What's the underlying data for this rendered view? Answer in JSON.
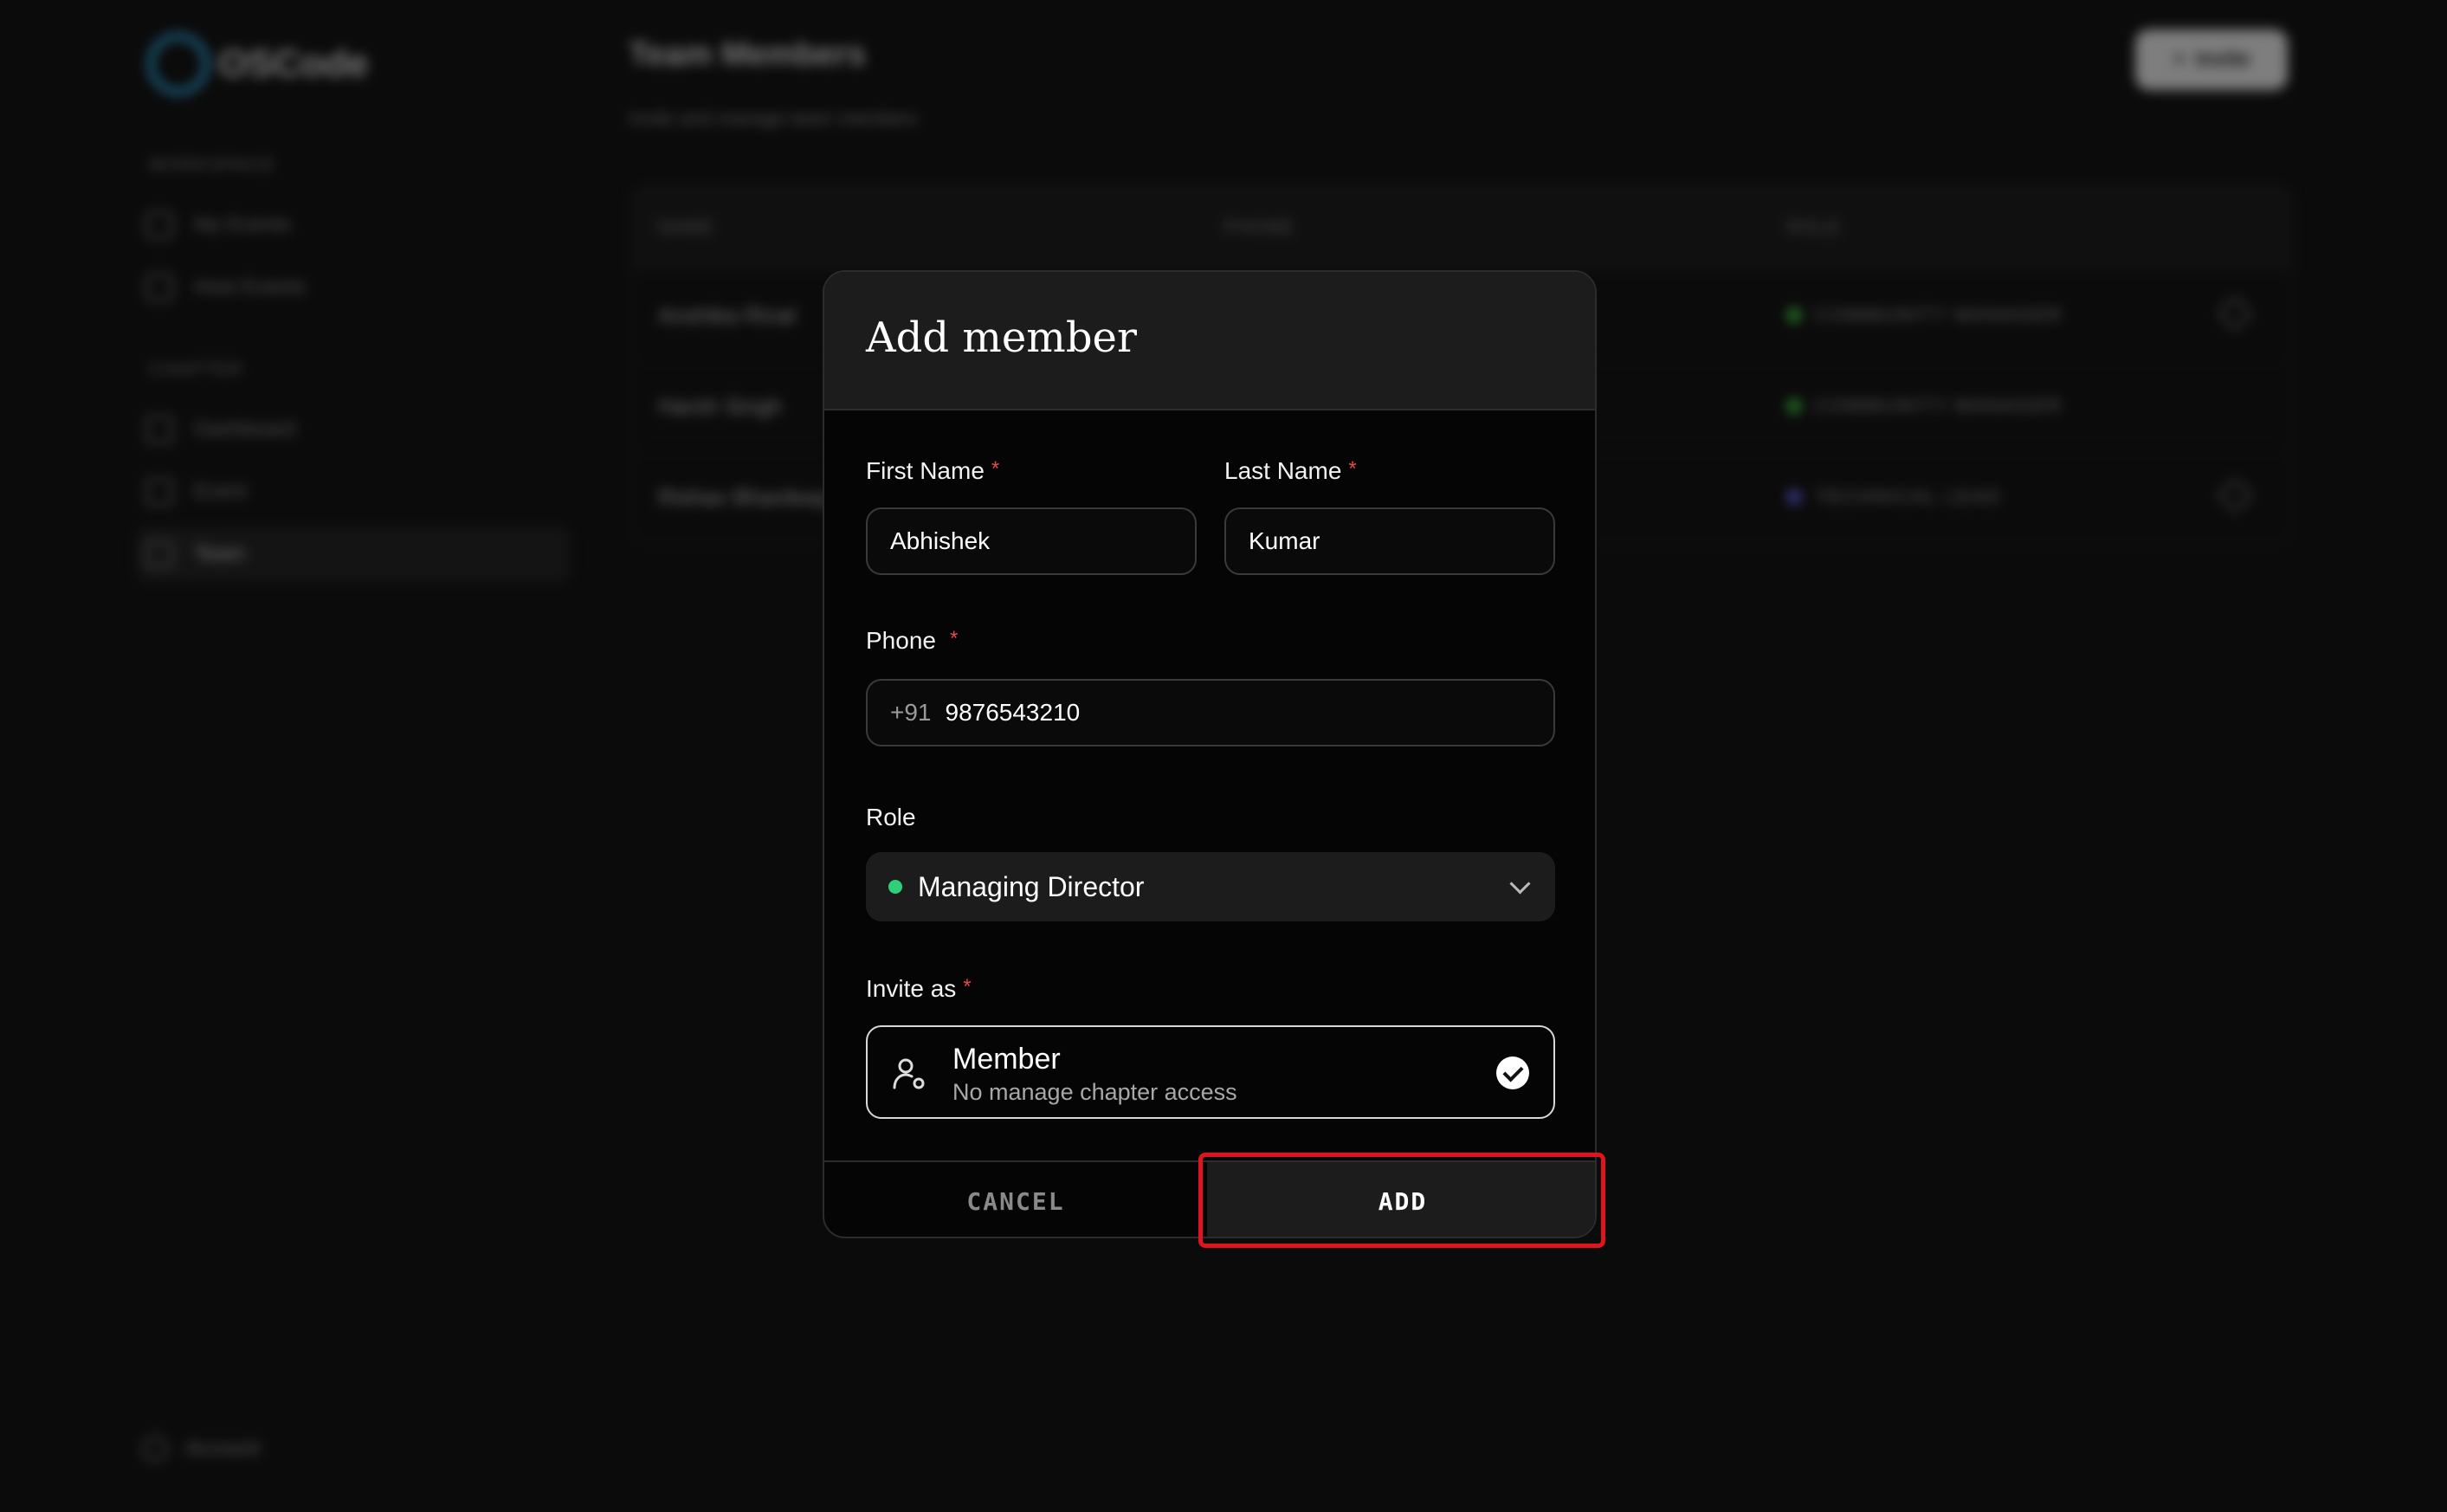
{
  "background": {
    "logo_text": "OSCode",
    "sidebar": {
      "sections": [
        {
          "title": "WORKSPACE",
          "items": [
            {
              "label": "My Events"
            },
            {
              "label": "Host Events"
            }
          ]
        },
        {
          "title": "CHAPTER",
          "items": [
            {
              "label": "Dashboard"
            },
            {
              "label": "Event"
            },
            {
              "label": "Team"
            }
          ]
        }
      ],
      "account_label": "Account"
    },
    "page_title": "Team Members",
    "page_subtitle": "Invite and manage team members",
    "invite_button_label": "Invite",
    "table": {
      "headers": [
        "NAME",
        "PHONE",
        "ROLE"
      ],
      "rows": [
        {
          "name": "Anshika Rinal",
          "role": "COMMUNITY MANAGER",
          "role_color": "#3fbf3f"
        },
        {
          "name": "Harsh Singh",
          "role": "COMMUNITY MANAGER",
          "role_color": "#3fbf3f"
        },
        {
          "name": "Rishav Bhardwaj",
          "role": "TECHNICAL LEAD",
          "role_color": "#5b5be6"
        }
      ]
    }
  },
  "modal": {
    "title": "Add member",
    "first_name": {
      "label": "First Name",
      "value": "Abhishek"
    },
    "last_name": {
      "label": "Last Name",
      "value": "Kumar"
    },
    "phone": {
      "label": "Phone",
      "prefix": "+91",
      "value": "9876543210"
    },
    "role": {
      "label": "Role",
      "selected": "Managing Director",
      "dot_color": "#2fd07a"
    },
    "invite_as": {
      "label": "Invite as",
      "option_title": "Member",
      "option_desc": "No manage chapter access",
      "selected": true
    },
    "required_mark": "*",
    "cancel_label": "CANCEL",
    "add_label": "ADD"
  },
  "colors": {
    "highlight": "#e0141c",
    "required": "#e5484d"
  }
}
